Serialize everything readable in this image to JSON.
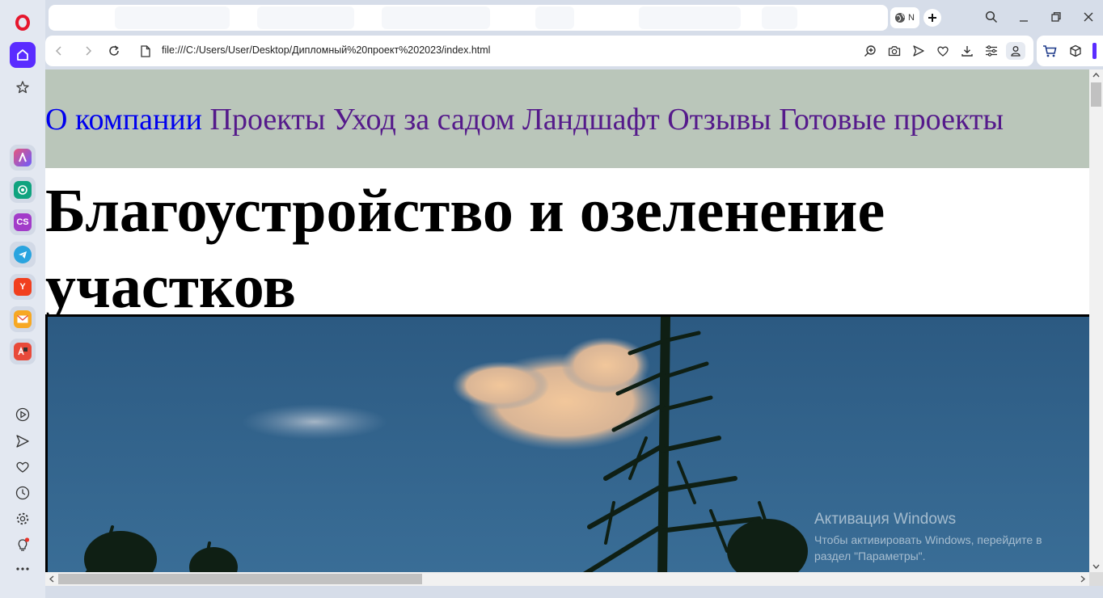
{
  "browser": {
    "url": "file:///C:/Users/User/Desktop/Дипломный%20проект%202023/index.html",
    "active_tab_title": "N",
    "accent": "#5a2cff",
    "sidebar_apps": [
      {
        "name": "aria",
        "label": "",
        "color": "#e7577b"
      },
      {
        "name": "chatgpt",
        "label": "",
        "color": "#10a37f"
      },
      {
        "name": "cs",
        "label": "CS",
        "color": "#a23cc9"
      },
      {
        "name": "telegram",
        "label": "",
        "color": "#2aa4df"
      },
      {
        "name": "yandex",
        "label": "Y",
        "color": "#f13f1e"
      },
      {
        "name": "mail",
        "label": "",
        "color": "#f7a823"
      },
      {
        "name": "translate",
        "label": "",
        "color": "#e84a3a"
      }
    ]
  },
  "page": {
    "nav": [
      {
        "label": "О компании",
        "color": "#0000ee"
      },
      {
        "label": "Проекты",
        "color": "#551a8b"
      },
      {
        "label": "Уход за садом",
        "color": "#551a8b"
      },
      {
        "label": "Ландшафт",
        "color": "#551a8b"
      },
      {
        "label": "Отзывы",
        "color": "#551a8b"
      },
      {
        "label": "Готовые проекты",
        "color": "#551a8b"
      }
    ],
    "heading": "Благоустройство и озеленение участков",
    "header_bg": "#bac6ba"
  },
  "overlay": {
    "title": "Активация Windows",
    "line1": "Чтобы активировать Windows, перейдите в",
    "line2": "раздел \"Параметры\"."
  }
}
